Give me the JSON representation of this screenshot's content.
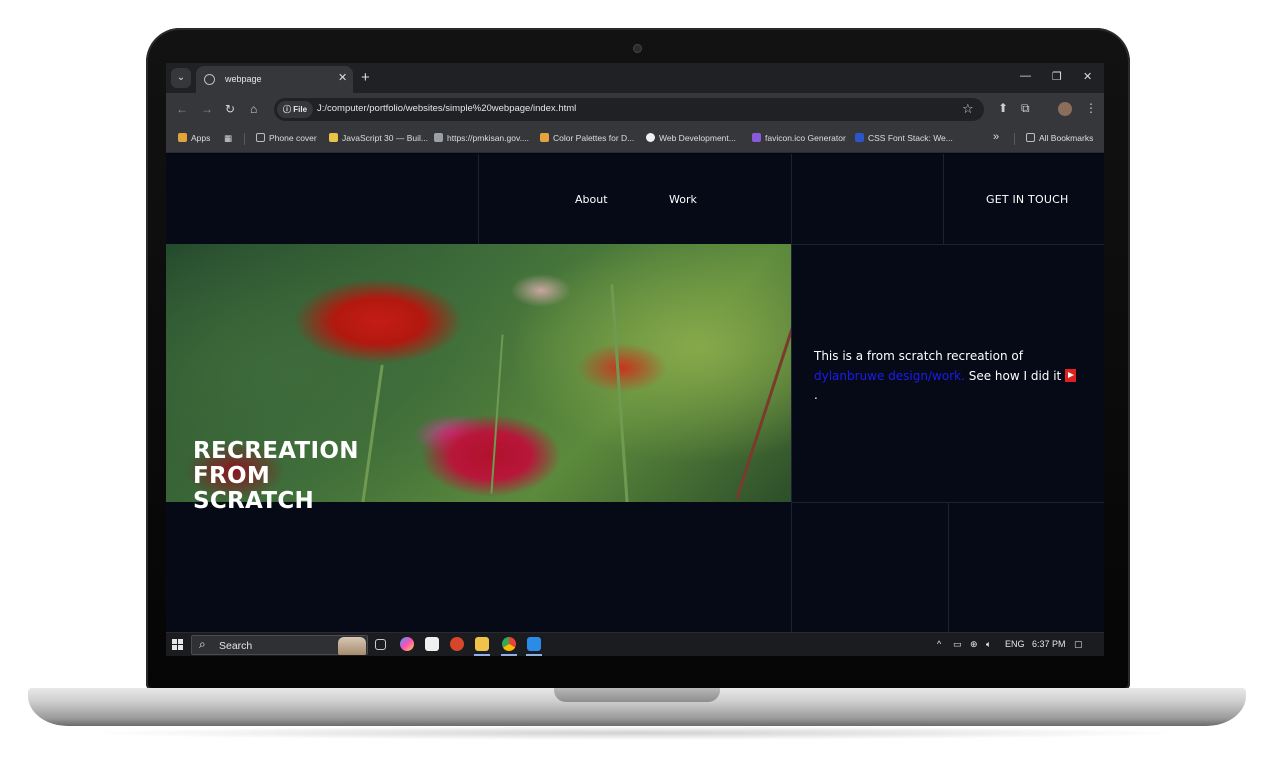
{
  "browser": {
    "tab_title": "webpage",
    "url_chip": "File",
    "url": "J:/computer/portfolio/websites/simple%20webpage/index.html",
    "bookmarks": [
      {
        "label": "Apps",
        "color": "#e2a33b"
      },
      {
        "label": "Phone cover",
        "color": "#9aa0a6"
      },
      {
        "label": "JavaScript 30 — Buil...",
        "color": "#e8c547"
      },
      {
        "label": "https://pmkisan.gov....",
        "color": "#9aa0a6"
      },
      {
        "label": "Color Palettes for D...",
        "color": "#e6a23c"
      },
      {
        "label": "Web Development...",
        "color": "#f0f0f0"
      },
      {
        "label": "favicon.ico Generator",
        "color": "#8a5bd8"
      },
      {
        "label": "CSS Font Stack: We...",
        "color": "#2b55c8"
      }
    ],
    "more_bookmarks": "»",
    "all_bookmarks": "All Bookmarks"
  },
  "page": {
    "nav": {
      "about": "About",
      "work": "Work",
      "cta": "GET IN TOUCH"
    },
    "hero_text": {
      "before_link": "This is a from scratch recreation of ",
      "link": "dylanbruwe design/work.",
      "after_link": " See how I did it ",
      "end": "."
    },
    "title_lines": [
      "RECREATION",
      "FROM",
      "SCRATCH"
    ]
  },
  "taskbar": {
    "search_placeholder": "Search",
    "language": "ENG",
    "time": "6:37 PM"
  },
  "colors": {
    "page_bg": "#050a16",
    "link": "#1c1cf0",
    "accent_red": "#e02020"
  }
}
